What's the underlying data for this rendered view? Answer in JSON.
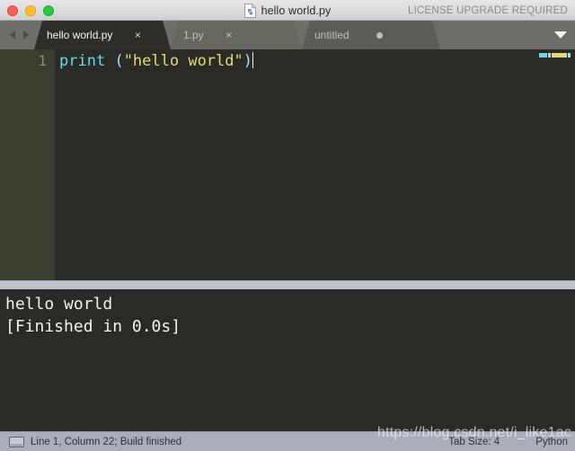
{
  "window": {
    "title": "hello world.py",
    "license_notice": "LICENSE UPGRADE REQUIRED",
    "doc_icon": "python-file-icon",
    "traffic_lights": {
      "close": "close-window-button",
      "minimize": "minimize-window-button",
      "zoom": "zoom-window-button"
    }
  },
  "tabbar": {
    "nav_back_icon": "arrow-left-icon",
    "nav_forward_icon": "arrow-right-icon",
    "overflow_icon": "chevron-down-icon",
    "tabs": [
      {
        "label": "hello world.py",
        "active": true,
        "close_glyph": "×",
        "modified": false
      },
      {
        "label": "1.py",
        "active": false,
        "close_glyph": "×",
        "modified": false
      },
      {
        "label": "untitled",
        "active": false,
        "close_glyph": "",
        "modified": true
      }
    ]
  },
  "editor": {
    "line_number": "1",
    "code": {
      "fn": "print",
      "space": " ",
      "open_paren": "(",
      "string": "\"hello world\"",
      "close_paren": ")"
    },
    "colors": {
      "background": "#2A2B26",
      "gutter": "#3C3D31",
      "function": "#66D9EF",
      "string": "#E6DB74",
      "paren": "#9FE1F0",
      "linenumber": "#8D8D82"
    }
  },
  "output": {
    "lines": [
      "hello world",
      "[Finished in 0.0s]"
    ]
  },
  "statusbar": {
    "console_icon": "console-monitor-icon",
    "left_text": "Line 1, Column 22; Build finished",
    "tab_size": "Tab Size: 4",
    "syntax": "Python"
  },
  "watermark": {
    "text": "https://blog.csdn.net/i_like1ac"
  }
}
